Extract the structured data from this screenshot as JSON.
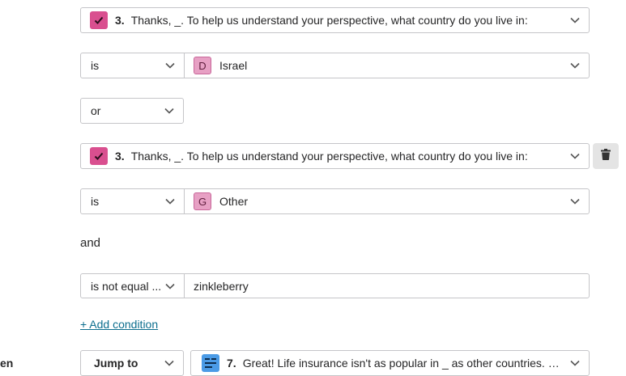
{
  "condition1": {
    "question_number": "3.",
    "question_text": "Thanks, _. To help us understand your perspective, what country do you live in:",
    "operator": "is",
    "value_letter": "D",
    "value": "Israel"
  },
  "joiner_or": "or",
  "condition2": {
    "question_number": "3.",
    "question_text": "Thanks, _. To help us understand your perspective, what country do you live in:",
    "operator": "is",
    "value_letter": "G",
    "value": "Other"
  },
  "joiner_and": "and",
  "condition3": {
    "operator": "is not equal ...",
    "value": "zinkleberry"
  },
  "add_condition_label": "+ Add condition",
  "then_label": "en",
  "action": {
    "type": "Jump to",
    "target_number": "7.",
    "target_text": "Great! Life insurance isn't as popular in _ as other countries. W..."
  },
  "colors": {
    "question_icon": "#d94f8f",
    "choice_badge": "#e7a0c4",
    "link": "#0c6e8e",
    "jump_icon": "#4b9be6"
  }
}
